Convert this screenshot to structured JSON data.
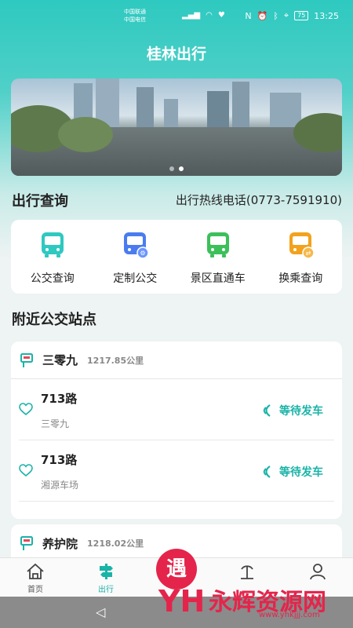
{
  "status_bar": {
    "carrier1": "中国联通",
    "carrier2": "中国电信",
    "battery": "75",
    "time": "13:25"
  },
  "app": {
    "title": "桂林出行"
  },
  "banner": {
    "slides": 2,
    "active_slide": 1
  },
  "travel_query": {
    "heading": "出行查询",
    "hotline": "出行热线电话(0773-7591910)"
  },
  "services": [
    {
      "label": "公交查询",
      "icon": "bus-icon",
      "color": "#2ec9c0"
    },
    {
      "label": "定制公交",
      "icon": "custom-bus-icon",
      "color": "#4a7cf0"
    },
    {
      "label": "景区直通车",
      "icon": "scenic-bus-icon",
      "color": "#3cc05a"
    },
    {
      "label": "换乘查询",
      "icon": "transfer-bus-icon",
      "color": "#f2a21c"
    }
  ],
  "nearby": {
    "heading": "附近公交站点",
    "stops": [
      {
        "name": "三零九",
        "distance": "1217.85公里",
        "routes": [
          {
            "number": "713路",
            "destination": "三零九",
            "status": "等待发车"
          },
          {
            "number": "713路",
            "destination": "湘源车场",
            "status": "等待发车"
          }
        ]
      },
      {
        "name": "养护院",
        "distance": "1218.02公里",
        "routes": []
      }
    ]
  },
  "tabs": [
    {
      "label": "首页",
      "icon": "home-icon"
    },
    {
      "label": "出行",
      "icon": "travel-icon",
      "active": true
    },
    {
      "label": "",
      "icon": "center-icon"
    },
    {
      "label": "",
      "icon": "scenic-icon"
    },
    {
      "label": "",
      "icon": "profile-icon"
    }
  ],
  "watermark": {
    "glyph": "遇",
    "text": "永辉资源网",
    "url": "www.yhkjjj.com",
    "mark": "YH"
  },
  "colors": {
    "accent": "#1ab3a8",
    "header_gradient_top": "#2ec9c0",
    "watermark": "#e5244b"
  }
}
